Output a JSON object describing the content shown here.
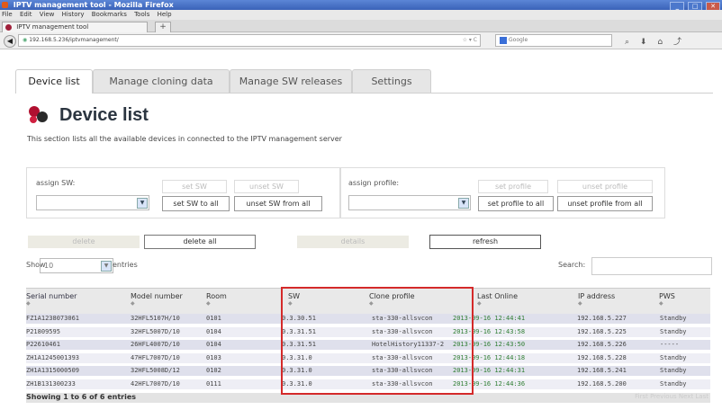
{
  "window": {
    "title": "IPTV management tool - Mozilla Firefox",
    "controls": [
      "_",
      "□",
      "✕"
    ]
  },
  "menu": [
    "File",
    "Edit",
    "View",
    "History",
    "Bookmarks",
    "Tools",
    "Help"
  ],
  "browser_tab": {
    "title": "IPTV management tool",
    "new_tab": "+"
  },
  "address": {
    "url": "192.168.5.236/iptvmanagement/",
    "search_engine": "Google"
  },
  "tabs": [
    "Device list",
    "Manage cloning data",
    "Manage SW releases",
    "Settings"
  ],
  "page": {
    "title": "Device list",
    "description": "This section lists all the available devices in connected to the IPTV management server"
  },
  "sw_panel": {
    "label": "assign SW:",
    "set": "set SW",
    "unset": "unset SW",
    "set_all": "set SW to all",
    "unset_all": "unset SW from all"
  },
  "profile_panel": {
    "label": "assign profile:",
    "set": "set profile",
    "unset": "unset profile",
    "set_all": "set profile to all",
    "unset_all": "unset profile from all"
  },
  "actions": {
    "delete": "delete",
    "delete_all": "delete all",
    "details": "details",
    "refresh": "refresh"
  },
  "table_controls": {
    "show_label": "Show",
    "show_value": "10",
    "entries": "entries",
    "search_label": "Search:"
  },
  "columns": [
    "Serial number",
    "Model number",
    "Room",
    "SW",
    "Clone profile",
    "Last Online",
    "IP address",
    "PWS"
  ],
  "rows": [
    [
      "FZ1A1238073061",
      "32HFL5107H/10",
      "0101",
      "0.3.30.51",
      "sta-330-allsvcon",
      "2013-09-16 12:44:41",
      "192.168.5.227",
      "Standby"
    ],
    [
      "P21809595",
      "32HFL5007D/10",
      "0104",
      "0.3.31.51",
      "sta-330-allsvcon",
      "2013-09-16 12:43:58",
      "192.168.5.225",
      "Standby"
    ],
    [
      "P22610461",
      "26HFL4007D/10",
      "0104",
      "0.3.31.51",
      "HotelHistory11337-2",
      "2013-09-16 12:43:50",
      "192.168.5.226",
      "-----"
    ],
    [
      "ZH1A1245001393",
      "47HFL7007D/10",
      "0103",
      "0.3.31.0",
      "sta-330-allsvcon",
      "2013-09-16 12:44:18",
      "192.168.5.228",
      "Standby"
    ],
    [
      "ZH1A1315000509",
      "32HFL5008D/12",
      "0102",
      "0.3.31.0",
      "sta-330-allsvcon",
      "2013-09-16 12:44:31",
      "192.168.5.241",
      "Standby"
    ],
    [
      "ZH1B131300233",
      "42HFL7007D/10",
      "0111",
      "0.3.31.0",
      "sta-330-allsvcon",
      "2013-09-16 12:44:36",
      "192.168.5.200",
      "Standby"
    ]
  ],
  "footer": {
    "info": "Showing 1 to 6 of 6 entries",
    "pagination": "First Previous Next Last"
  },
  "colors": {
    "highlight_box": "#d42a2a",
    "last_online_text": "#2e7d32",
    "row_odd": "#dfe0ec",
    "row_even": "#eeeef5"
  }
}
